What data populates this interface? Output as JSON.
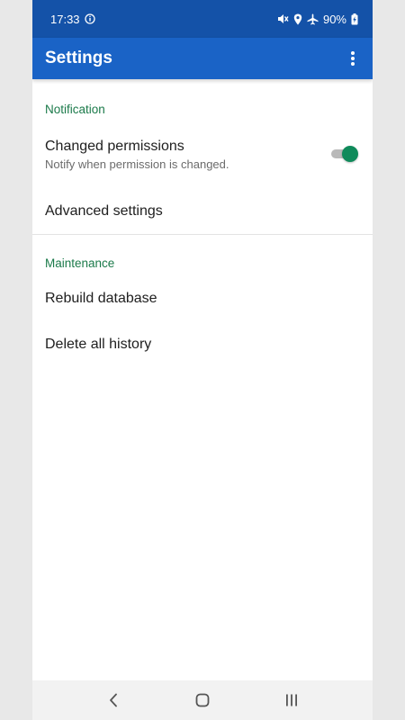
{
  "status_bar": {
    "time": "17:33",
    "battery": "90%",
    "icons": [
      "info-icon",
      "mute-icon",
      "location-icon",
      "airplane-icon",
      "battery-charging-icon"
    ]
  },
  "app_bar": {
    "title": "Settings",
    "menu_icon": "more-vert-icon"
  },
  "sections": {
    "notification": {
      "header": "Notification",
      "changed_permissions": {
        "title": "Changed permissions",
        "summary": "Notify when permission is changed.",
        "enabled": true
      },
      "advanced": {
        "title": "Advanced settings"
      }
    },
    "maintenance": {
      "header": "Maintenance",
      "rebuild": {
        "title": "Rebuild database"
      },
      "delete_history": {
        "title": "Delete all history"
      }
    }
  },
  "colors": {
    "status_bar": "#1452a8",
    "app_bar": "#1a63c6",
    "section_header": "#1b7a4a",
    "toggle_on": "#0f8a5a"
  },
  "nav_bar": {
    "icons": [
      "back-icon",
      "home-icon",
      "recents-icon"
    ]
  }
}
